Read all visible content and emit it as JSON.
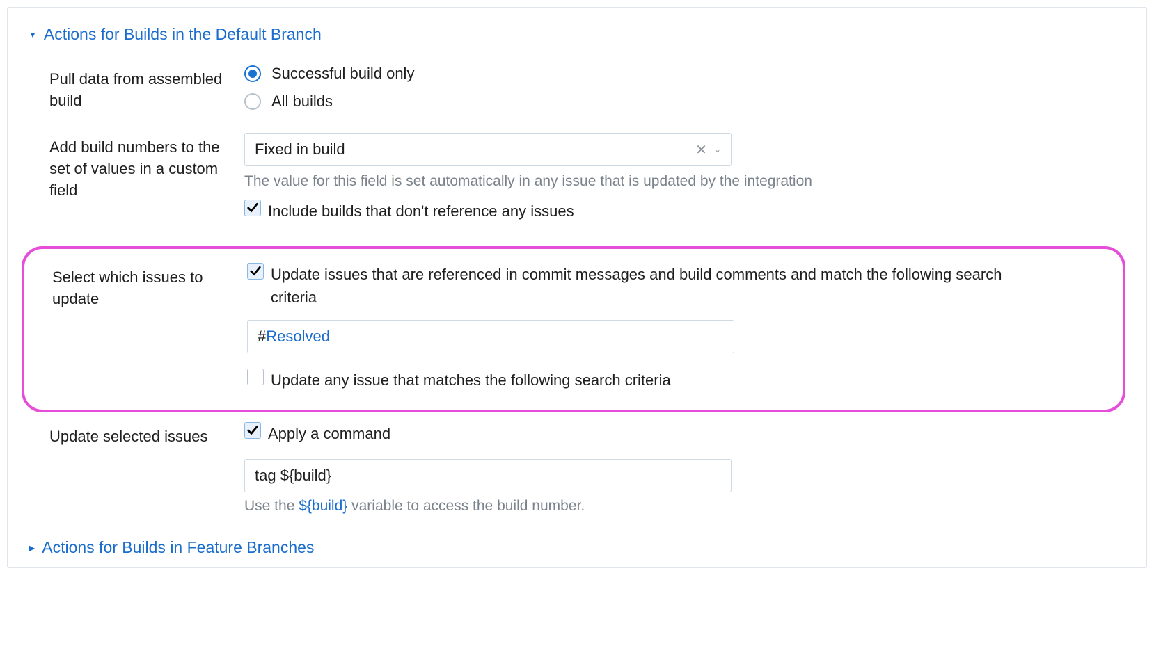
{
  "sections": {
    "default_branch": {
      "title": "Actions for Builds in the Default Branch",
      "expanded": true
    },
    "feature_branch": {
      "title": "Actions for Builds in Feature Branches",
      "expanded": false
    }
  },
  "fields": {
    "pull_data": {
      "label": "Pull data from assembled build",
      "options": {
        "success_only": "Successful build only",
        "all_builds": "All builds"
      },
      "selected": "success_only"
    },
    "add_build_numbers": {
      "label": "Add build numbers to the set of values in a custom field",
      "select_value": "Fixed in build",
      "helper": "The value for this field is set automatically in any issue that is updated by the integration",
      "include_unref": "Include builds that don't reference any issues",
      "include_unref_checked": true
    },
    "select_issues": {
      "label": "Select which issues to update",
      "update_referenced": "Update issues that are referenced in commit messages and build comments and match the following search criteria",
      "update_referenced_checked": true,
      "search_query": {
        "hash": "#",
        "tag": "Resolved"
      },
      "update_any": "Update any issue that matches the following search criteria",
      "update_any_checked": false
    },
    "update_selected": {
      "label": "Update selected issues",
      "apply_command": "Apply a command",
      "apply_command_checked": true,
      "command_text": {
        "prefix": "tag ",
        "variable": "${build}"
      },
      "helper_prefix": "Use the ",
      "helper_variable": "${build}",
      "helper_suffix": " variable to access the build number."
    }
  }
}
